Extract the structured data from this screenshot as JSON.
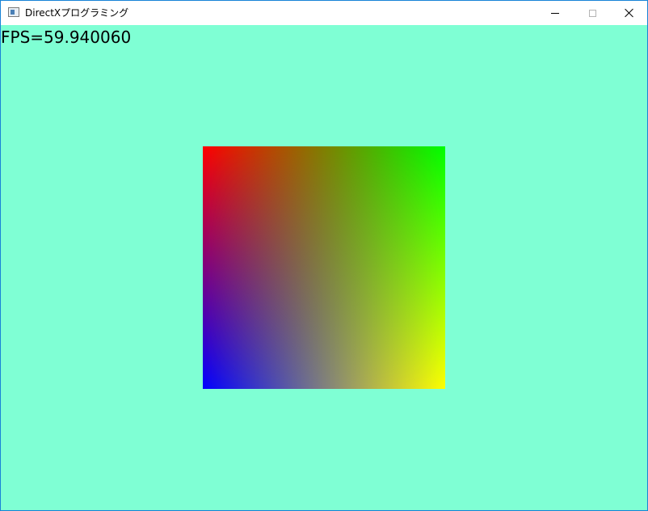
{
  "window": {
    "title": "DirectXプログラミング",
    "app_icon": "window-app-icon",
    "controls": {
      "minimize_icon": "minimize-icon",
      "maximize_icon": "maximize-icon",
      "close_icon": "close-icon"
    }
  },
  "viewport": {
    "background_color": "#7fffd4",
    "fps_text": "FPS=59.940060",
    "quad": {
      "corner_colors": {
        "top_left": "#ff0000",
        "top_right": "#00ff00",
        "bottom_left": "#0000ff",
        "bottom_right": "#ffff00"
      }
    }
  }
}
